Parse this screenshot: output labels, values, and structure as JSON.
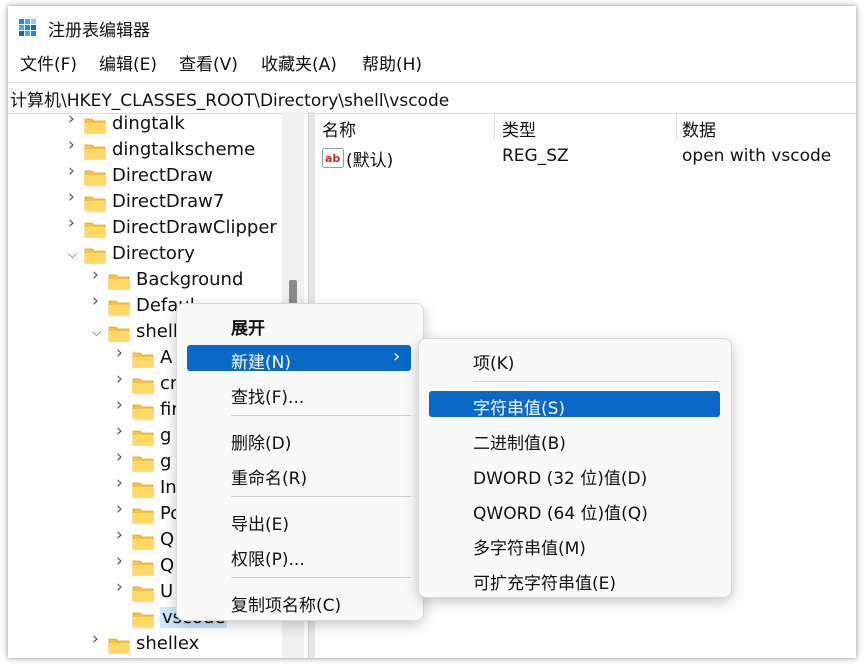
{
  "window": {
    "title": "注册表编辑器"
  },
  "menubar": [
    {
      "label": "文件(F)"
    },
    {
      "label": "编辑(E)"
    },
    {
      "label": "查看(V)"
    },
    {
      "label": "收藏夹(A)"
    },
    {
      "label": "帮助(H)"
    }
  ],
  "address": "计算机\\HKEY_CLASSES_ROOT\\Directory\\shell\\vscode",
  "tree": [
    {
      "label": "dingtalk",
      "expanded": false
    },
    {
      "label": "dingtalkscheme",
      "expanded": false
    },
    {
      "label": "DirectDraw",
      "expanded": false
    },
    {
      "label": "DirectDraw7",
      "expanded": false
    },
    {
      "label": "DirectDrawClipper",
      "expanded": false
    },
    {
      "label": "Directory",
      "expanded": true
    },
    {
      "label": "Background",
      "expanded": false
    },
    {
      "label": "Defaul",
      "expanded": false
    },
    {
      "label": "shell",
      "expanded": true
    },
    {
      "label": "A",
      "expanded": false
    },
    {
      "label": "cr",
      "expanded": false
    },
    {
      "label": "fir",
      "expanded": false
    },
    {
      "label": "g",
      "expanded": false
    },
    {
      "label": "g",
      "expanded": false
    },
    {
      "label": "In",
      "expanded": false
    },
    {
      "label": "Po",
      "expanded": false
    },
    {
      "label": "Q",
      "expanded": false
    },
    {
      "label": "Q",
      "expanded": false
    },
    {
      "label": "U",
      "expanded": false
    },
    {
      "label": "vscode",
      "selected": true
    },
    {
      "label": "shellex",
      "expanded": false
    }
  ],
  "list": {
    "columns": [
      "名称",
      "类型",
      "数据"
    ],
    "rows": [
      {
        "name": "(默认)",
        "type": "REG_SZ",
        "data": "open with vscode",
        "icon": "string-value-icon"
      }
    ]
  },
  "context_menu": {
    "items": [
      {
        "label": "展开",
        "bold": true
      },
      {
        "label": "新建(N)",
        "highlighted": true,
        "submenu": true
      },
      {
        "label": "查找(F)..."
      },
      {
        "label": "删除(D)"
      },
      {
        "label": "重命名(R)"
      },
      {
        "label": "导出(E)"
      },
      {
        "label": "权限(P)..."
      },
      {
        "label": "复制项名称(C)"
      }
    ],
    "submenu_arrow": "›"
  },
  "submenu": {
    "items": [
      {
        "label": "项(K)"
      },
      {
        "label": "字符串值(S)",
        "highlighted": true
      },
      {
        "label": "二进制值(B)"
      },
      {
        "label": "DWORD (32 位)值(D)"
      },
      {
        "label": "QWORD (64 位)值(Q)"
      },
      {
        "label": "多字符串值(M)"
      },
      {
        "label": "可扩充字符串值(E)"
      }
    ]
  },
  "colors": {
    "highlight": "#0a68c6",
    "folder": "#f5c542",
    "selection": "#cce8ff"
  }
}
